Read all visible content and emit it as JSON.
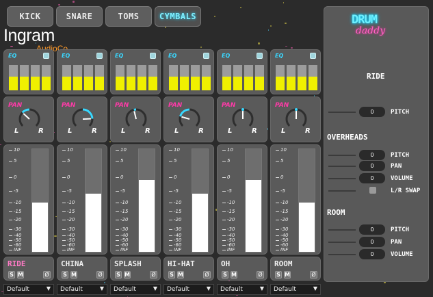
{
  "tabs": [
    {
      "label": "KICK",
      "active": false
    },
    {
      "label": "SNARE",
      "active": false
    },
    {
      "label": "TOMS",
      "active": false
    },
    {
      "label": "CYMBALS",
      "active": true
    }
  ],
  "logo": {
    "brand": "Ingram",
    "sub": "AudioCo."
  },
  "eq_label": "EQ",
  "pan_label": "PAN",
  "pan_left": "L",
  "pan_right": "R",
  "scale": [
    "10",
    "5",
    "0",
    "-5",
    "-10",
    "-15",
    "-20",
    "-30",
    "-40",
    "-50",
    "-60",
    "INF"
  ],
  "channels": [
    {
      "name": "RIDE",
      "selected": true,
      "pan": -0.35,
      "volume": 0.48,
      "solo": "S",
      "mute": "M",
      "mute_icon": "Ø",
      "preset": "Default"
    },
    {
      "name": "CHINA",
      "selected": false,
      "pan": 0.65,
      "volume": 0.57,
      "solo": "S",
      "mute": "M",
      "mute_icon": "Ø",
      "preset": "Default"
    },
    {
      "name": "SPLASH",
      "selected": false,
      "pan": -0.1,
      "volume": 0.7,
      "solo": "S",
      "mute": "M",
      "mute_icon": "Ø",
      "preset": "Default"
    },
    {
      "name": "HI-HAT",
      "selected": false,
      "pan": -0.55,
      "volume": 0.57,
      "solo": "S",
      "mute": "M",
      "mute_icon": "Ø",
      "preset": "Default"
    },
    {
      "name": "OH",
      "selected": false,
      "pan": 0.0,
      "volume": 0.7,
      "solo": "S",
      "mute": "M",
      "mute_icon": "Ø",
      "preset": "Default"
    },
    {
      "name": "ROOM",
      "selected": false,
      "pan": 0.0,
      "volume": 0.48,
      "solo": "S",
      "mute": "M",
      "mute_icon": "Ø",
      "preset": "Default"
    }
  ],
  "right_panel": {
    "logo_top": "DRUM",
    "logo_bottom": "daddy",
    "selected_title": "RIDE",
    "selected_rows": [
      {
        "value": "0",
        "label": "PITCH"
      }
    ],
    "overheads_title": "OVERHEADS",
    "overheads_rows": [
      {
        "value": "0",
        "label": "PITCH"
      },
      {
        "value": "0",
        "label": "PAN"
      },
      {
        "value": "0",
        "label": "VOLUME"
      }
    ],
    "lr_swap_label": "L/R SWAP",
    "room_title": "ROOM",
    "room_rows": [
      {
        "value": "0",
        "label": "PITCH"
      },
      {
        "value": "0",
        "label": "PAN"
      },
      {
        "value": "0",
        "label": "VOLUME"
      }
    ]
  },
  "colors": {
    "accent_cyan": "#3ad7ff",
    "accent_pink": "#ff3aa8",
    "eq_yellow": "#f0f000"
  }
}
